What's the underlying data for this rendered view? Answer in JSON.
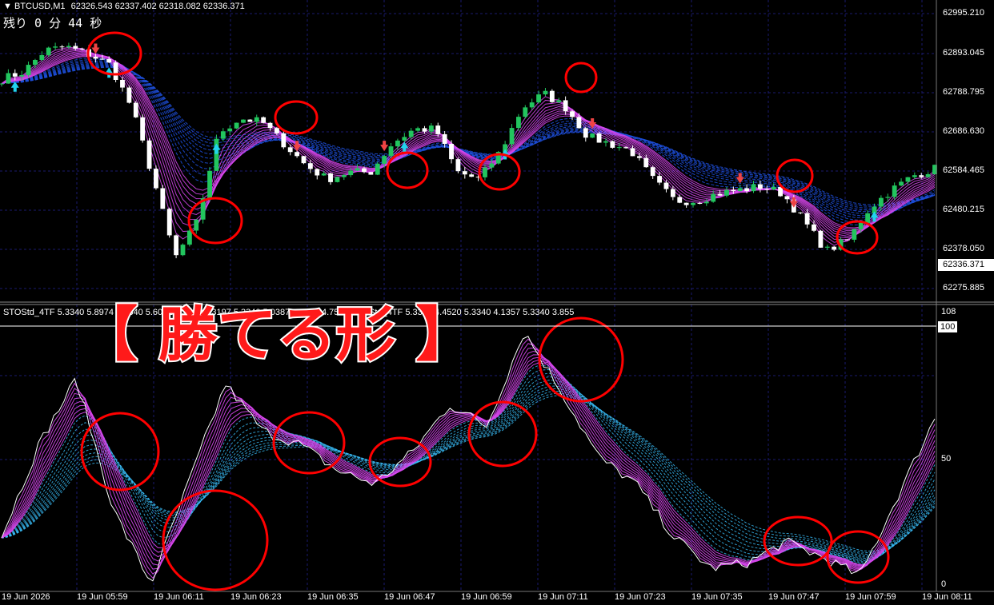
{
  "header": {
    "symbol": "BTCUSD,M1",
    "ohlc": "62326.543 62337.402 62318.082 62336.371",
    "remaining": "残り 0 分 44 秒"
  },
  "price_axis": {
    "labels": [
      "62995.210",
      "62893.045",
      "62788.795",
      "62686.630",
      "62584.465",
      "62480.215",
      "62378.050",
      "62275.885"
    ],
    "current_price": "62336.371"
  },
  "indicator": {
    "header": "STOStd_4TF 5.3340 5.8974 5.3340 5.6061 5.3340 5.3197 5.3340 5.0387 5.3340 4.7549   STOStd_4TF 5.3340 4.4520 5.3340 4.1357 5.3340 3.855",
    "scale_top": "108",
    "scale_100": "100",
    "scale_50": "50",
    "scale_0": "0"
  },
  "time_axis": {
    "labels": [
      "19 Jun 2026",
      "19 Jun 05:59",
      "19 Jun 06:11",
      "19 Jun 06:23",
      "19 Jun 06:35",
      "19 Jun 06:47",
      "19 Jun 06:59",
      "19 Jun 07:11",
      "19 Jun 07:23",
      "19 Jun 07:35",
      "19 Jun 07:47",
      "19 Jun 07:59",
      "19 Jun 08:11"
    ]
  },
  "overlay": {
    "title": "【 勝てる形 】"
  },
  "colors": {
    "background": "#000000",
    "grid": "#1a1a6e",
    "bull_candle": "#22c55e",
    "bear_candle": "#ffffff",
    "ribbon_magenta": "#d946ef",
    "ribbon_blue": "#1d4ed8",
    "highlight_circle": "#ff0000",
    "up_arrow": "#22d3ee",
    "down_arrow": "#ef4444"
  },
  "chart_data": {
    "type": "line",
    "title": "",
    "series": [
      {
        "values": [
          62840,
          62860,
          62920,
          62930,
          62910,
          62880,
          62760,
          62560,
          62340,
          62440,
          62690,
          62730,
          62720,
          62660,
          62600,
          62560,
          62580,
          62580,
          62660,
          62700,
          62700,
          62580,
          62560,
          62640,
          62760,
          62800,
          62760,
          62680,
          62660,
          62640,
          62560,
          62500,
          62500,
          62520,
          62530,
          62540,
          62520,
          62440,
          62360,
          62390,
          62480,
          62530,
          62570,
          62590
        ]
      }
    ],
    "ylim": [
      62230,
      63050
    ]
  }
}
